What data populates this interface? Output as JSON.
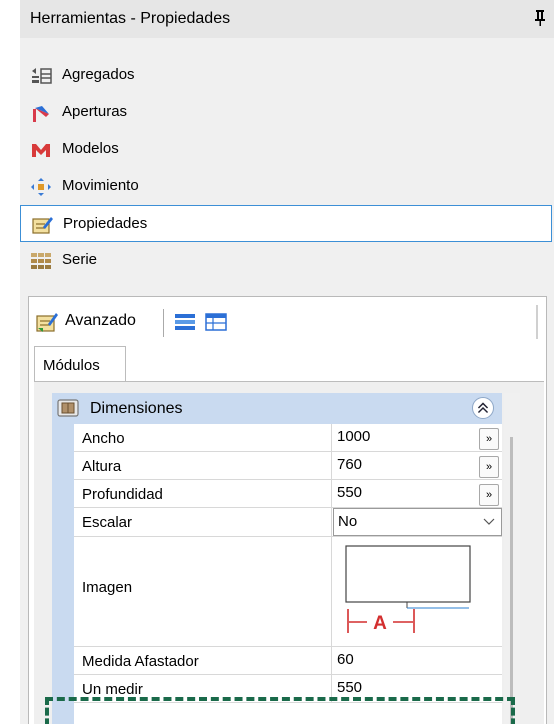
{
  "window": {
    "title": "Herramientas - Propiedades",
    "pin_icon": "pin-icon"
  },
  "nav": {
    "items": [
      {
        "label": "Agregados",
        "icon": "agregados-icon"
      },
      {
        "label": "Aperturas",
        "icon": "aperturas-icon"
      },
      {
        "label": "Modelos",
        "icon": "modelos-icon"
      },
      {
        "label": "Movimiento",
        "icon": "movimiento-icon"
      },
      {
        "label": "Propiedades",
        "icon": "propiedades-icon",
        "selected": true
      },
      {
        "label": "Serie",
        "icon": "serie-icon"
      }
    ]
  },
  "toolbar": {
    "advanced_label": "Avanzado"
  },
  "tabs": [
    {
      "label": "Módulos",
      "active": true
    }
  ],
  "category": {
    "label": "Dimensiones",
    "collapse_symbol": "»"
  },
  "properties": {
    "ancho": {
      "name": "Ancho",
      "value": "1000",
      "button": "»"
    },
    "altura": {
      "name": "Altura",
      "value": "760",
      "button": "»"
    },
    "profundidad": {
      "name": "Profundidad",
      "value": "550",
      "button": "»"
    },
    "escalar": {
      "name": "Escalar",
      "value": "No"
    },
    "imagen": {
      "name": "Imagen",
      "preview_text": "A"
    },
    "medida_afastador": {
      "name": "Medida Afastador",
      "value": "60"
    },
    "un_medir": {
      "name": "Un medir",
      "value": "550"
    }
  },
  "colors": {
    "accent": "#3c8fd6",
    "category_bg": "#c9daf0",
    "highlight": "#1a6a4a",
    "preview_red": "#d32f2f"
  }
}
